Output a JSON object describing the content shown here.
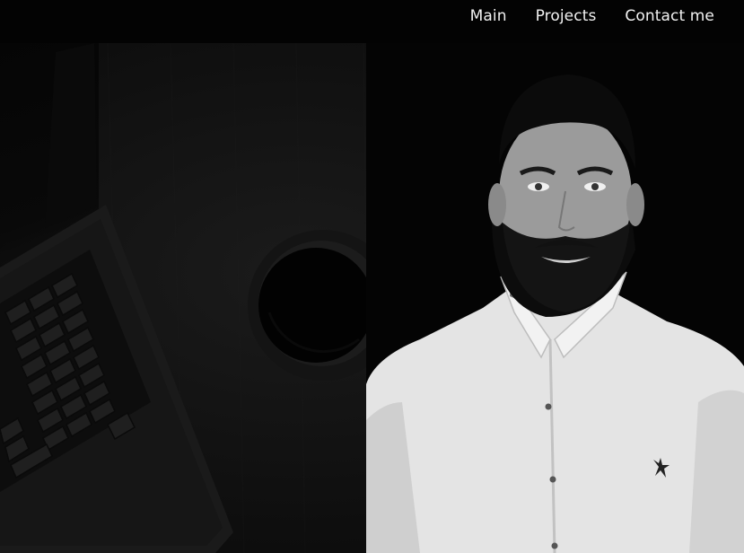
{
  "nav": {
    "items": [
      {
        "label": "Main"
      },
      {
        "label": "Projects"
      },
      {
        "label": "Contact me"
      }
    ]
  },
  "colors": {
    "background": "#060606",
    "nav_text": "#f2f2f2",
    "shirt": "#e6e6e6"
  },
  "hero": {
    "background_image": "laptop-and-coffee-desk-photo",
    "portrait": "man-in-white-shirt-photo"
  }
}
